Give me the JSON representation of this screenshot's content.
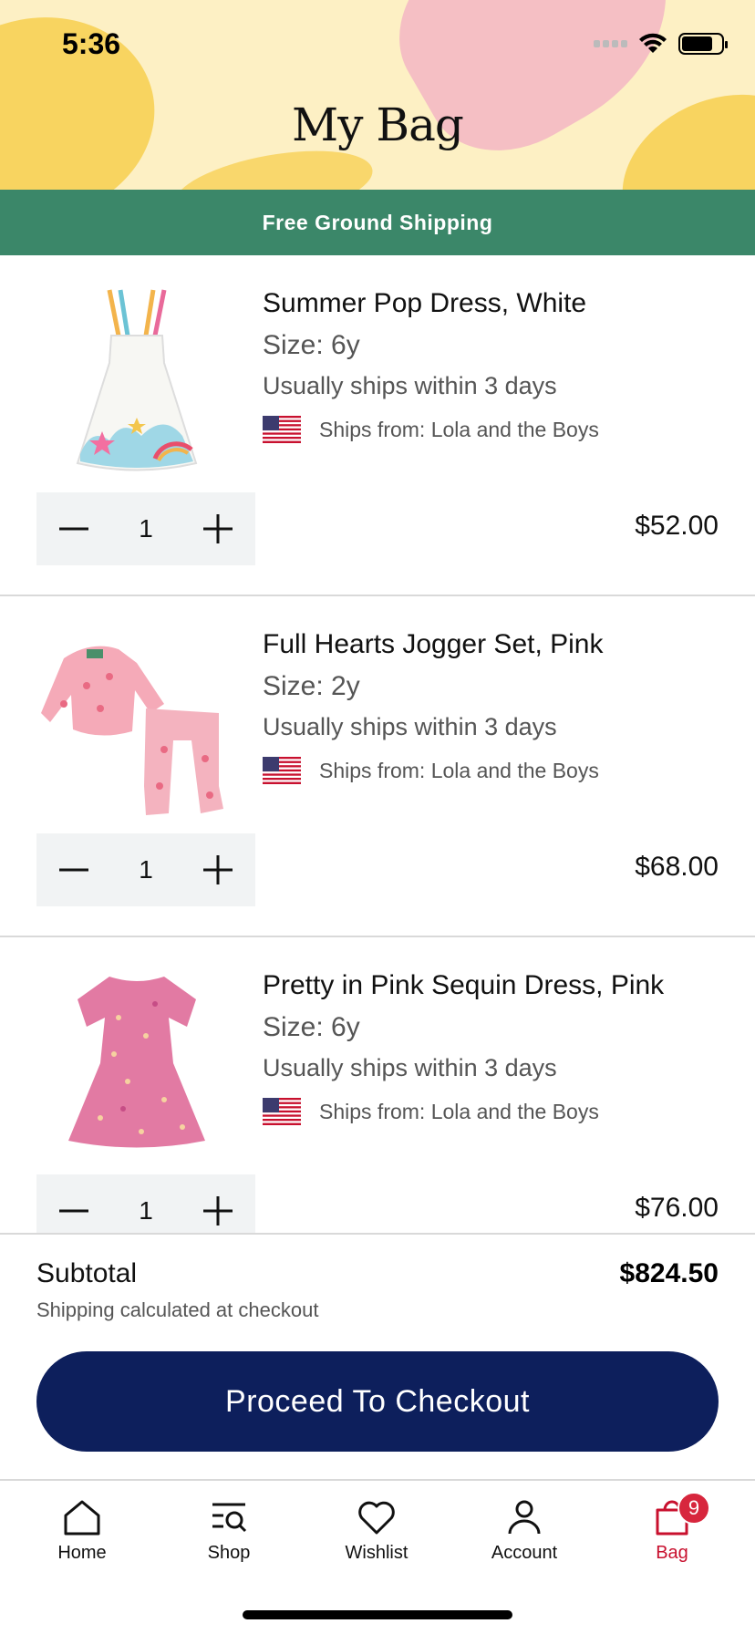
{
  "status_bar": {
    "time": "5:36"
  },
  "header": {
    "title": "My Bag"
  },
  "banner": {
    "text": "Free Ground Shipping"
  },
  "items": [
    {
      "name": "Summer Pop Dress, White",
      "size": "Size: 6y",
      "shipping": "Usually ships within 3 days",
      "ships_from": "Ships from: Lola and the Boys",
      "quantity": "1",
      "price": "$52.00"
    },
    {
      "name": "Full Hearts Jogger Set, Pink",
      "size": "Size: 2y",
      "shipping": "Usually ships within 3 days",
      "ships_from": "Ships from: Lola and the Boys",
      "quantity": "1",
      "price": "$68.00"
    },
    {
      "name": "Pretty in Pink Sequin Dress, Pink",
      "size": "Size: 6y",
      "shipping": "Usually ships within 3 days",
      "ships_from": "Ships from: Lola and the Boys",
      "quantity": "1",
      "price": "$76.00"
    }
  ],
  "summary": {
    "subtotal_label": "Subtotal",
    "subtotal_value": "$824.50",
    "shipping_note": "Shipping calculated at checkout",
    "checkout_label": "Proceed To Checkout"
  },
  "tabbar": {
    "tabs": [
      {
        "label": "Home",
        "icon": "home-icon"
      },
      {
        "label": "Shop",
        "icon": "shop-search-icon"
      },
      {
        "label": "Wishlist",
        "icon": "heart-icon"
      },
      {
        "label": "Account",
        "icon": "person-icon"
      },
      {
        "label": "Bag",
        "icon": "bag-icon",
        "badge": "9",
        "active": true
      }
    ]
  },
  "colors": {
    "header_bg": "#fdf0c4",
    "banner_bg": "#3b8769",
    "checkout_bg": "#0d1f5c",
    "active_tab": "#c8102e",
    "badge_bg": "#d7263d"
  }
}
